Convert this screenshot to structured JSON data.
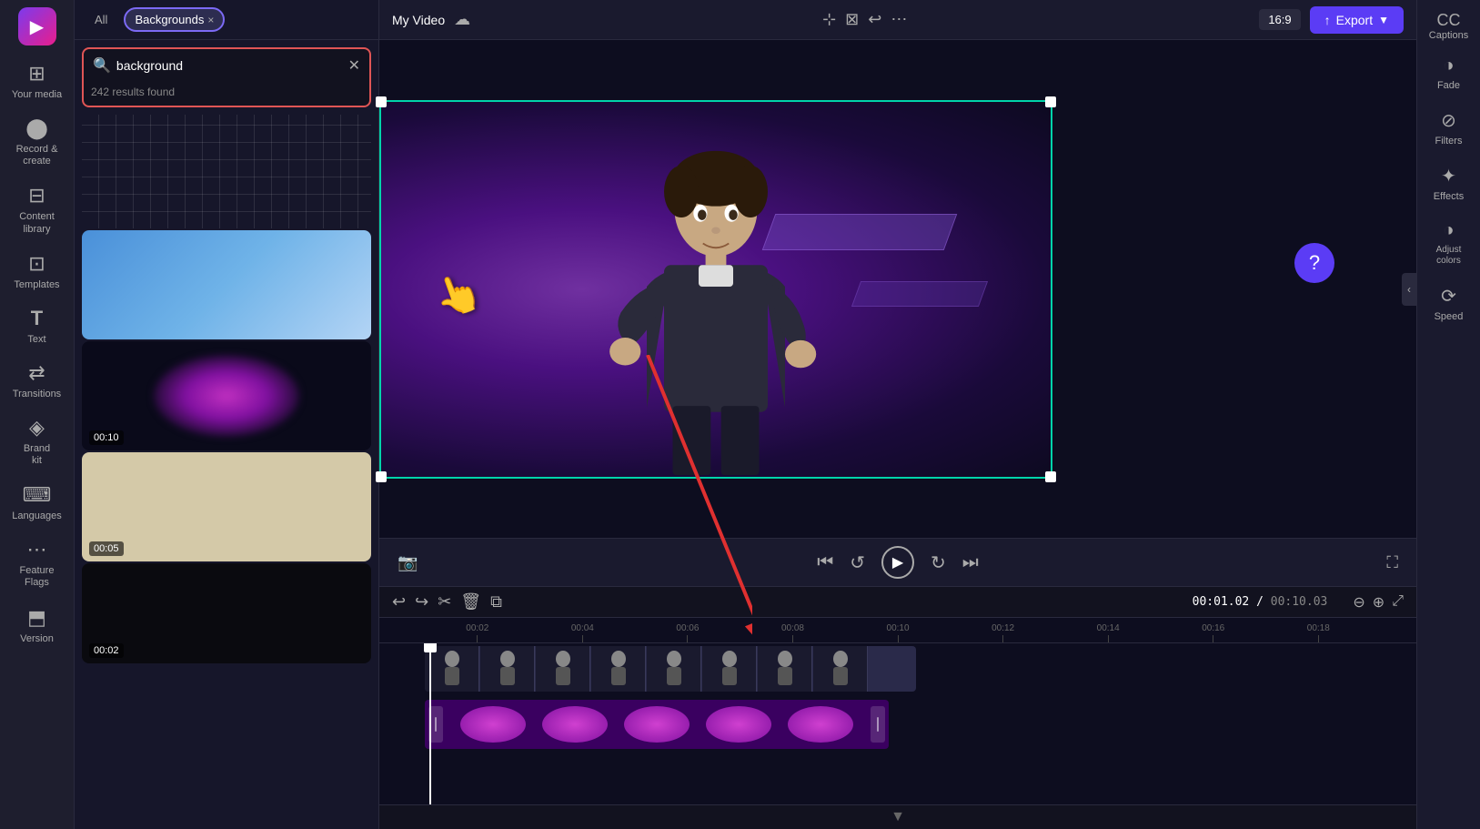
{
  "app": {
    "logo": "▶",
    "title": "My Video"
  },
  "sidebar": {
    "items": [
      {
        "id": "your-media",
        "label": "Your media",
        "icon": "⊞"
      },
      {
        "id": "record-create",
        "label": "Record &\ncreate",
        "icon": "⬤"
      },
      {
        "id": "content-library",
        "label": "Content library",
        "icon": "⊟"
      },
      {
        "id": "templates",
        "label": "Templates",
        "icon": "⊡"
      },
      {
        "id": "text",
        "label": "Text",
        "icon": "T"
      },
      {
        "id": "transitions",
        "label": "Transitions",
        "icon": "⇄"
      },
      {
        "id": "brand",
        "label": "Brand kit",
        "icon": "◈"
      },
      {
        "id": "languages",
        "label": "Languages",
        "icon": "⌨"
      },
      {
        "id": "feature-flags",
        "label": "Feature Flags",
        "icon": "⋯"
      },
      {
        "id": "version",
        "label": "Version",
        "icon": "⬒"
      }
    ]
  },
  "search_panel": {
    "tab_all": "All",
    "tab_backgrounds": "Backgrounds",
    "tab_close": "×",
    "search_placeholder": "background",
    "search_value": "background",
    "results_count": "242 results found",
    "media_items": [
      {
        "id": "yellow-grid",
        "type": "yellow",
        "duration": null
      },
      {
        "id": "blue-gradient",
        "type": "blue",
        "duration": null
      },
      {
        "id": "purple-oval",
        "type": "purple_oval",
        "duration": "00:10"
      },
      {
        "id": "beige",
        "type": "beige",
        "duration": "00:05"
      },
      {
        "id": "dark",
        "type": "dark",
        "duration": "00:02"
      }
    ]
  },
  "top_bar": {
    "video_title": "My Video",
    "aspect_ratio": "16:9",
    "export_label": "Export",
    "captions_label": "Captions"
  },
  "timeline": {
    "current_time": "00:01.02",
    "separator": " / ",
    "total_time": "00:10.03",
    "ruler_marks": [
      "00:02",
      "00:04",
      "00:06",
      "00:08",
      "00:10",
      "00:12",
      "00:14",
      "00:16",
      "00:18"
    ]
  },
  "right_sidebar": {
    "items": [
      {
        "id": "fade",
        "label": "Fade",
        "icon": "◑"
      },
      {
        "id": "filters",
        "label": "Filters",
        "icon": "⊘"
      },
      {
        "id": "effects",
        "label": "Effects",
        "icon": "✦"
      },
      {
        "id": "adjust-colors",
        "label": "Adjust colors",
        "icon": "◑"
      },
      {
        "id": "speed",
        "label": "Speed",
        "icon": "⟳"
      }
    ]
  },
  "colors": {
    "accent": "#5b3cf5",
    "brand": "#e91e8c",
    "preview_border": "#00d4aa",
    "search_border": "#e05555"
  }
}
